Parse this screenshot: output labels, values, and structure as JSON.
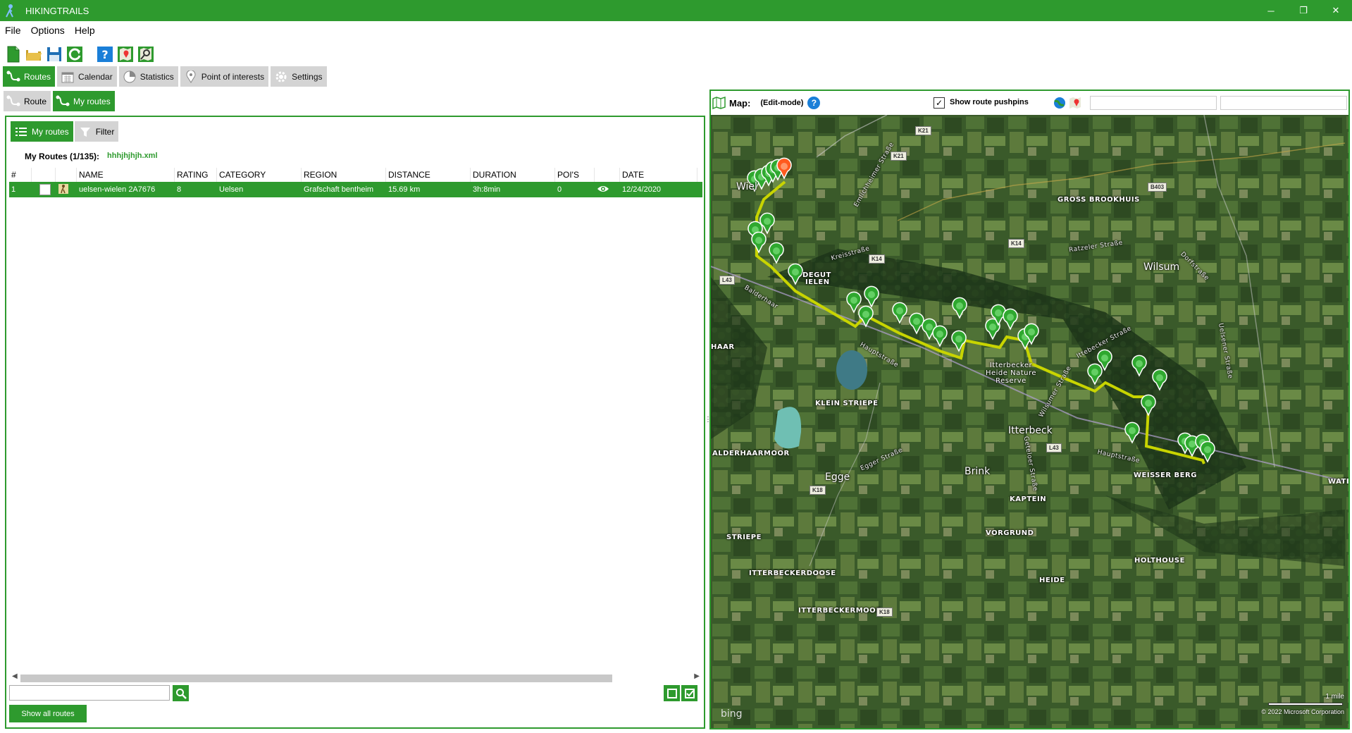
{
  "app": {
    "title": "HIKINGTRAILS"
  },
  "window": {
    "minimize": "─",
    "restore": "❐",
    "close": "✕"
  },
  "menu": [
    "File",
    "Options",
    "Help"
  ],
  "toolbar": [
    "new-file-icon",
    "open-folder-icon",
    "save-icon",
    "refresh-icon",
    "help-icon",
    "map-icon",
    "map-search-icon"
  ],
  "tabs": [
    {
      "label": "Routes",
      "active": true
    },
    {
      "label": "Calendar",
      "active": false
    },
    {
      "label": "Statistics",
      "active": false
    },
    {
      "label": "Point of interests",
      "active": false
    },
    {
      "label": "Settings",
      "active": false
    }
  ],
  "subtabs": [
    {
      "label": "Route",
      "active": false
    },
    {
      "label": "My routes",
      "active": true
    }
  ],
  "inner_tabs": [
    {
      "label": "My routes",
      "active": true
    },
    {
      "label": "Filter",
      "active": false
    }
  ],
  "list": {
    "title": "My Routes (1/135):",
    "file": "hhhjhjhjh.xml",
    "columns": [
      "#",
      "",
      "",
      "NAME",
      "RATING",
      "CATEGORY",
      "REGION",
      "DISTANCE",
      "DURATION",
      "POI'S",
      "",
      "DATE"
    ],
    "rows": [
      {
        "num": "1",
        "name": "uelsen-wielen 2A7676",
        "rating": "8",
        "category": "Uelsen",
        "region": "Grafschaft bentheim",
        "distance": "15.69 km",
        "duration": "3h:8min",
        "pois": "0",
        "date": "12/24/2020"
      }
    ]
  },
  "search": {
    "placeholder": "",
    "show_all": "Show all routes"
  },
  "map": {
    "label": "Map:",
    "mode": "(Edit-mode)",
    "help": "?",
    "show_pushpins_label": "Show route pushpins",
    "show_pushpins_checked": true,
    "check_mark": "✓",
    "towns": [
      "Wiel",
      "Wilsum",
      "Itterbeck",
      "Egge",
      "Brink"
    ],
    "places": [
      "GROSS BROOKHUIS",
      "DEGUT",
      "IELEN",
      "KLEIN STRIEPE",
      "ALDERHAARMOOR",
      "WEISSER BERG",
      "WATE",
      "KAPTEIN",
      "VORGRUND",
      "STRIEPE",
      "HOLTHOUSE",
      "ITTERBECKERDOOSE",
      "HEIDE",
      "ITTERBECKERMOOR",
      "HAAR"
    ],
    "reserve": [
      "Itterbecker",
      "Heide Nature",
      "Reserve"
    ],
    "roads": [
      "Emlichheimer Straße",
      "Ratzeler Straße",
      "Kreisstraße",
      "Balderhaar",
      "Hauptstraße",
      "Ittebecker Straße",
      "Uelsener Straße",
      "Egger Straße",
      "Hauptstraße",
      "Dorfstraße",
      "Wilsumer Straße",
      "Geteloer Straße"
    ],
    "shields": [
      "K21",
      "K21",
      "B403",
      "K14",
      "K14",
      "L43",
      "L43",
      "K18",
      "K18"
    ],
    "logo": "bing",
    "scale": "1 mile",
    "copyright": "© 2022 Microsoft Corporation",
    "colors": {
      "route": "#c8d400",
      "pin": "#2fa82f",
      "pin_end": "#ff5a1f"
    }
  },
  "colors": {
    "accent": "#2e9a2e"
  }
}
